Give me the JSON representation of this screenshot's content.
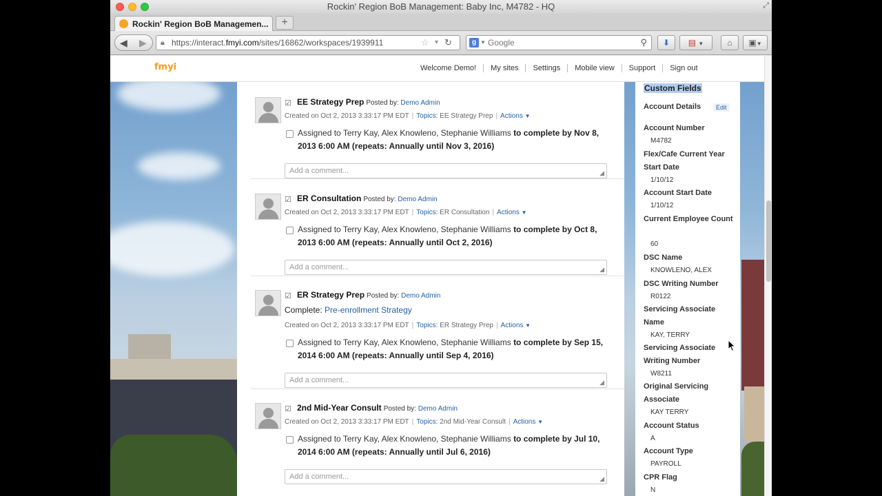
{
  "window": {
    "title": "Rockin' Region BoB Management: Baby Inc, M4782 - HQ"
  },
  "tab": {
    "title": "Rockin' Region BoB Managemen..."
  },
  "url": {
    "prefix": "https://interact.",
    "domain": "fmyi.com",
    "path": "/sites/16862/workspaces/1939911"
  },
  "search": {
    "placeholder": "Google"
  },
  "site": {
    "logo": "fmyi",
    "nav": [
      "Welcome Demo!",
      "My sites",
      "Settings",
      "Mobile view",
      "Support",
      "Sign out"
    ]
  },
  "posts": [
    {
      "title": "EE Strategy Prep",
      "posted_by_label": "Posted by:",
      "author": "Demo Admin",
      "created": "Created on Oct 2, 2013 3:33:17 PM EDT",
      "topics_label": "Topics:",
      "topic": "EE Strategy Prep",
      "actions": "Actions",
      "assign_plain": "Assigned to Terry Kay, Alex Knowleno, Stephanie Williams",
      "assign_bold": "to complete by  Nov 8, 2013 6:00 AM (repeats: Annually until Nov 3, 2016)",
      "comment_placeholder": "Add a comment..."
    },
    {
      "title": "ER Consultation",
      "posted_by_label": "Posted by:",
      "author": "Demo Admin",
      "created": "Created on Oct 2, 2013 3:33:17 PM EDT",
      "topics_label": "Topics:",
      "topic": "ER Consultation",
      "actions": "Actions",
      "assign_plain": "Assigned to Terry Kay, Alex Knowleno, Stephanie Williams",
      "assign_bold": "to complete by  Oct 8, 2013 6:00 AM (repeats: Annually until Oct 2, 2016)",
      "comment_placeholder": "Add a comment..."
    },
    {
      "title": "ER Strategy Prep",
      "posted_by_label": "Posted by:",
      "author": "Demo Admin",
      "complete_label": "Complete:",
      "complete_link": "Pre-enrollment Strategy",
      "created": "Created on Oct 2, 2013 3:33:17 PM EDT",
      "topics_label": "Topics:",
      "topic": "ER Strategy Prep",
      "actions": "Actions",
      "assign_plain": "Assigned to Terry Kay, Alex Knowleno, Stephanie Williams",
      "assign_bold": "to complete by  Sep 15, 2014 6:00 AM (repeats: Annually until Sep 4, 2016)",
      "comment_placeholder": "Add a comment..."
    },
    {
      "title": "2nd Mid-Year Consult",
      "posted_by_label": "Posted by:",
      "author": "Demo Admin",
      "created": "Created on Oct 2, 2013 3:33:17 PM EDT",
      "topics_label": "Topics:",
      "topic": "2nd Mid-Year Consult",
      "actions": "Actions",
      "assign_plain": "Assigned to Terry Kay, Alex Knowleno, Stephanie Williams",
      "assign_bold": "to complete by  Jul 10, 2014 6:00 AM (repeats: Annually until Jul 6, 2016)",
      "comment_placeholder": "Add a comment..."
    }
  ],
  "sidebar": {
    "custom_fields": "Custom Fields",
    "account_details": "Account Details",
    "edit": "Edit",
    "fields": [
      {
        "label": "Account Number",
        "value": "M4782"
      },
      {
        "label": "Flex/Cafe Current Year Start Date",
        "value": "1/10/12"
      },
      {
        "label": "Account Start Date",
        "value": "1/10/12"
      },
      {
        "label": "Current Employee Count",
        "value": "60"
      },
      {
        "label": "DSC Name",
        "value": "KNOWLENO, ALEX"
      },
      {
        "label": "DSC Writing Number",
        "value": "R0122"
      },
      {
        "label": "Servicing Associate Name",
        "value": "KAY, TERRY"
      },
      {
        "label": "Servicing Associate Writing Number",
        "value": "W8211"
      },
      {
        "label": "Original Servicing Associate",
        "value": "KAY TERRY"
      },
      {
        "label": "Account Status",
        "value": "A"
      },
      {
        "label": "Account Type",
        "value": "PAYROLL"
      },
      {
        "label": "CPR Flag",
        "value": "N"
      }
    ]
  }
}
